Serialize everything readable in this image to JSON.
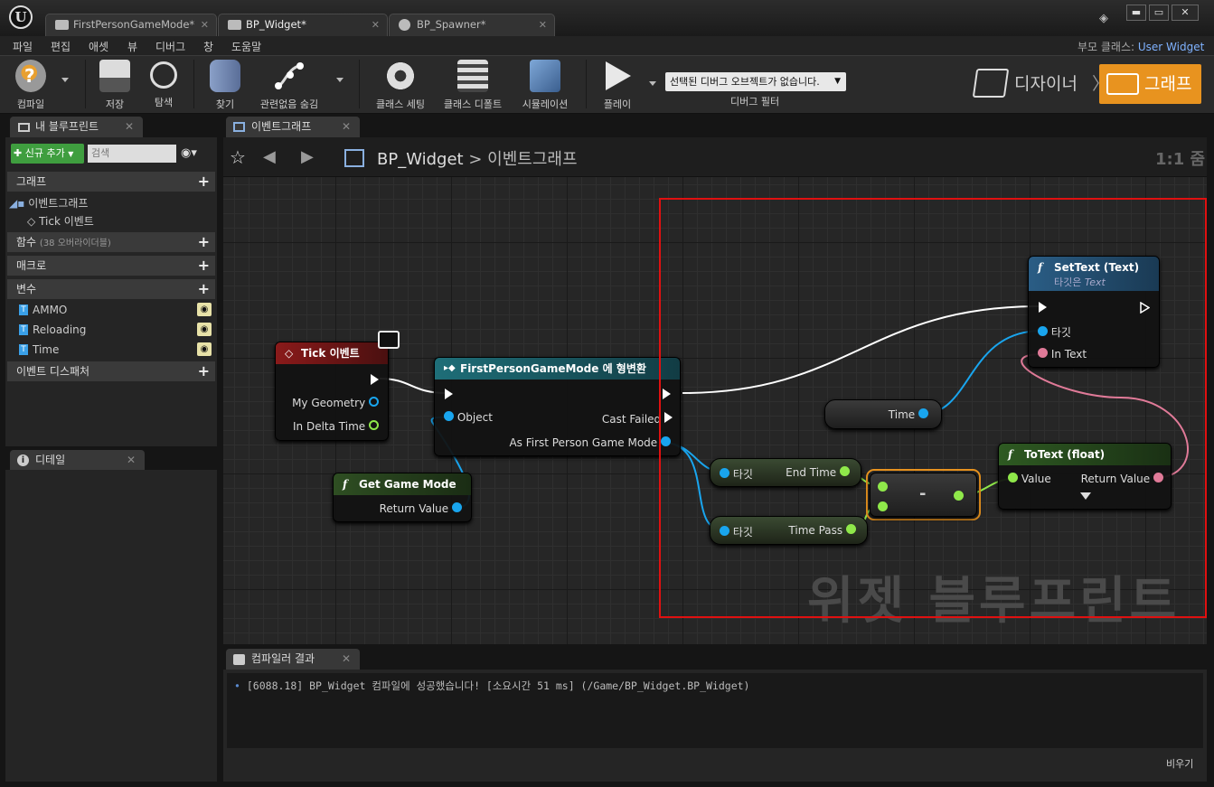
{
  "window": {
    "tabs": [
      {
        "label": "FirstPersonGameMode*"
      },
      {
        "label": "BP_Widget*"
      },
      {
        "label": "BP_Spawner*"
      }
    ],
    "controls": {
      "minimize": "▬",
      "maximize": "▭",
      "close": "✕"
    }
  },
  "menu": {
    "items": [
      "파일",
      "편집",
      "애셋",
      "뷰",
      "디버그",
      "창",
      "도움말"
    ],
    "parent_class_label": "부모 클래스:",
    "parent_class_value": "User Widget"
  },
  "toolbar": {
    "compile": "컴파일",
    "save": "저장",
    "browse": "탐색",
    "find": "찾기",
    "hide_unrelated": "관련없음 숨김",
    "class_settings": "클래스 세팅",
    "class_defaults": "클래스 디폴트",
    "simulation": "시뮬레이션",
    "play": "플레이",
    "debug_filter_value": "선택된 디버그 오브젝트가 없습니다.",
    "debug_filter_label": "디버그 필터",
    "designer": "디자이너",
    "graph": "그래프",
    "accent_color": "#e8931f"
  },
  "my_blueprint": {
    "title": "내 블루프린트",
    "add_new": "신규 추가",
    "search_placeholder": "검색",
    "graphs_header": "그래프",
    "event_graph": "이벤트그래프",
    "tick_event": "Tick 이벤트",
    "functions_header": "함수",
    "functions_note": "(38 오버라이더블)",
    "macros_header": "매크로",
    "variables_header": "변수",
    "variables": [
      "AMMO",
      "Reloading",
      "Time"
    ],
    "event_dispatchers_header": "이벤트 디스패처"
  },
  "details": {
    "title": "디테일"
  },
  "graph": {
    "tab_label": "이벤트그래프",
    "breadcrumb_root": "BP_Widget",
    "breadcrumb_sep": ">",
    "breadcrumb_leaf": "이벤트그래프",
    "zoom": "1:1 줌",
    "watermark": "위젯 블루프린트",
    "nodes": {
      "tick": {
        "title": "Tick 이벤트",
        "pins": [
          "My Geometry",
          "In Delta Time"
        ],
        "header_color": "#8a1a1a"
      },
      "cast": {
        "title": "FirstPersonGameMode 에 형변환",
        "pins": [
          "Object",
          "Cast Failed",
          "As First Person Game Mode"
        ],
        "header_color": "#1e6e78"
      },
      "get_game_mode": {
        "title": "Get Game Mode",
        "pins": [
          "Return Value"
        ],
        "header_color": "#2e4e22"
      },
      "set_text": {
        "title": "SetText (Text)",
        "subtitle_prefix": "타깃은",
        "subtitle_type": "Text",
        "pins": [
          "타깃",
          "In Text"
        ],
        "header_color": "#2a5d85"
      },
      "time_var": {
        "label": "Time"
      },
      "end_time": {
        "target": "타깃",
        "label": "End Time"
      },
      "time_pass": {
        "target": "타깃",
        "label": "Time Pass"
      },
      "subtract": {
        "symbol": "-"
      },
      "to_text": {
        "title": "ToText (float)",
        "pins": [
          "Value",
          "Return Value"
        ],
        "header_color": "#2e5a22"
      }
    }
  },
  "compiler": {
    "title": "컴파일러 결과",
    "log": "[6088.18] BP_Widget 컴파일에 성공했습니다! [소요시간 51 ms] (/Game/BP_Widget.BP_Widget)",
    "clear": "비우기"
  }
}
